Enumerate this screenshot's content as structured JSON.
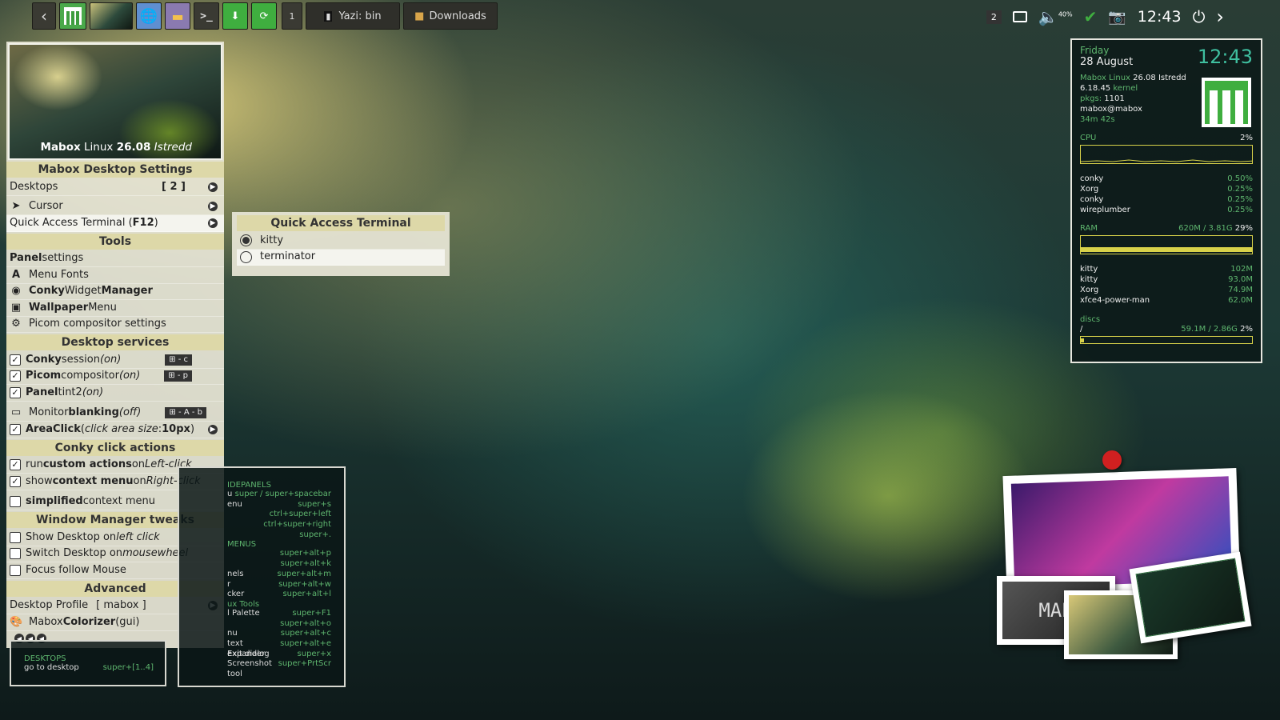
{
  "taskbar": {
    "workspace_num": "1",
    "tasks": [
      {
        "label": "Yazi: bin",
        "icon": "terminal-icon"
      },
      {
        "label": "Downloads",
        "icon": "folder-icon"
      }
    ]
  },
  "tray": {
    "desktop_count": "2",
    "volume_pct": "40%",
    "clock": "12:43"
  },
  "menu": {
    "banner_caption": {
      "b1": "Mabox",
      "r1": " Linux ",
      "b2": "26.08",
      "i": " Istredd"
    },
    "h_settings": "Mabox Desktop Settings",
    "desktops": "Desktops",
    "desktops_val": "[ 2 ]",
    "cursor": "Cursor",
    "qat": "Quick Access Terminal (",
    "qat_key": "F12",
    ")": ")",
    "h_tools": "Tools",
    "panel_b": "Panel",
    "panel_r": " settings",
    "menu_fonts": "Menu Fonts",
    "conky_b": "Conky",
    "conky_r": " Widget ",
    "conky_b2": "Manager",
    "wall_b": "Wallpaper",
    "wall_r": " Menu",
    "picom_settings": "Picom compositor settings",
    "h_services": "Desktop services",
    "s1_b": "Conky",
    "s1_r": " session ",
    "s1_i": "(on)",
    "s1_k": "- c",
    "s2_b": "Picom",
    "s2_r": " compositor ",
    "s2_i": "(on)",
    "s2_k": "- p",
    "s3_b": "Panel",
    "s3_r": " tint2 ",
    "s3_i": "(on)",
    "s4_r": "Monitor ",
    "s4_b": "blanking",
    "s4_i": " (off)",
    "s4_k": "- A - b",
    "s5_b": "AreaClick",
    "s5_r": " (",
    "s5_i": "click area size",
    "s5_r2": ": ",
    "s5_b2": "10px",
    "h_conky": "Conky click actions",
    "c1_r": "run ",
    "c1_b": "custom actions",
    "c1_r2": " on ",
    "c1_i": "Left-click",
    "c2_r": "show ",
    "c2_b": "context menu",
    "c2_r2": " on ",
    "c2_i": "Right-click",
    "c3_b": "simplified",
    "c3_r": " context menu",
    "h_wm": "Window Manager tweaks",
    "w1_r": "Show Desktop on ",
    "w1_i": "left click",
    "w2_r": "Switch Desktop on ",
    "w2_i": "mousewheel",
    "w3": "Focus follow Mouse",
    "h_adv": "Advanced",
    "profile": "Desktop Profile",
    "profile_val": "[ mabox ]",
    "colorizer_r": "Mabox ",
    "colorizer_b": "Colorizer",
    "colorizer_r2": " (gui)"
  },
  "submenu": {
    "title": "Quick Access Terminal",
    "options": [
      "kitty",
      "terminator"
    ]
  },
  "keybinds_left": {
    "head": "DESKTOPS",
    "row_l": "go to desktop",
    "row_r": "super+[1..4]"
  },
  "keybinds": {
    "head1": "IDEPANELS",
    "rows1": [
      [
        "u",
        "super / super+spacebar"
      ],
      [
        "enu",
        "super+s"
      ],
      [
        "",
        "ctrl+super+left"
      ],
      [
        "",
        "ctrl+super+right"
      ],
      [
        "",
        "super+."
      ]
    ],
    "head2": "MENUS",
    "rows2": [
      [
        "",
        "super+alt+p"
      ],
      [
        "",
        "super+alt+k"
      ],
      [
        "nels",
        "super+alt+m"
      ],
      [
        "r",
        "super+alt+w"
      ],
      [
        "cker",
        "super+alt+l"
      ]
    ],
    "head3": "ux Tools",
    "rows3": [
      [
        "l Palette",
        "super+F1"
      ],
      [
        "",
        "super+alt+o"
      ],
      [
        "nu",
        "super+alt+c"
      ],
      [
        "text expander",
        "super+alt+e"
      ],
      [
        "Exit dialog",
        "super+x"
      ],
      [
        "Screenshot tool",
        "super+PrtScr"
      ]
    ]
  },
  "conky": {
    "day": "Friday",
    "date": "28 August",
    "time": "12:43",
    "distro_g": "Mabox Linux",
    "distro_v": " 26.08 Istredd",
    "kernel_v": "6.18.45",
    "kernel_l": " kernel",
    "pkgs_l": "pkgs:",
    "pkgs_v": " 1101",
    "user": "mabox@mabox",
    "uptime": "34m 42s",
    "cpu_label": "CPU",
    "cpu_pct": "2%",
    "cpu_procs": [
      [
        "conky",
        "0.50%"
      ],
      [
        "Xorg",
        "0.25%"
      ],
      [
        "conky",
        "0.25%"
      ],
      [
        "wireplumber",
        "0.25%"
      ]
    ],
    "ram_label": "RAM",
    "ram_used": "620M / 3.81G",
    "ram_pct": "29%",
    "ram_procs": [
      [
        "kitty",
        "102M"
      ],
      [
        "kitty",
        "93.0M"
      ],
      [
        "Xorg",
        "74.9M"
      ],
      [
        "xfce4-power-man",
        "62.0M"
      ]
    ],
    "disc_label": "discs",
    "disc_mount": "/",
    "disc_used": "59.1M / 2.86G",
    "disc_pct": "2%"
  },
  "photos": {
    "logo_text": "MAB"
  }
}
